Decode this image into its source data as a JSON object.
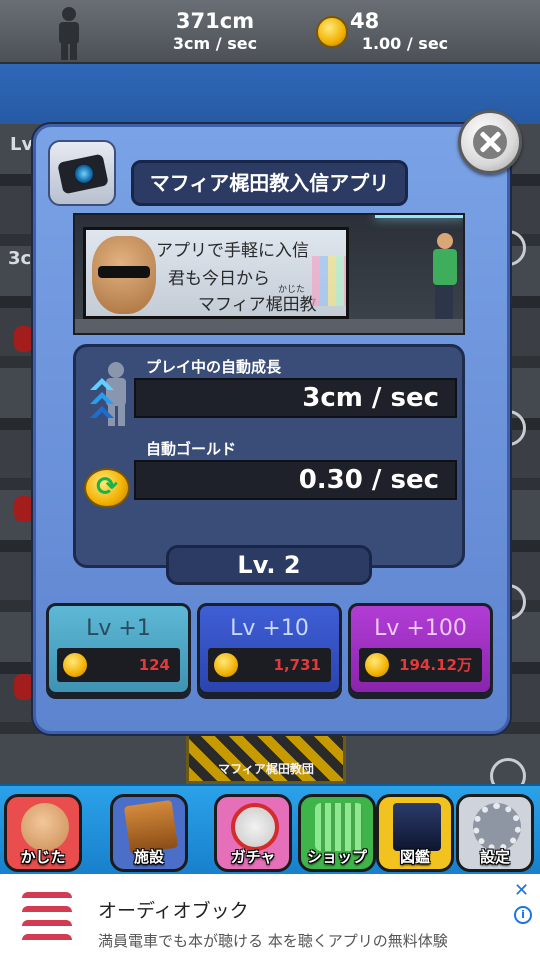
{
  "status_bar": {
    "height_total": "371cm",
    "height_rate": "3cm / sec",
    "gold_total": "48",
    "gold_rate": "1.00 / sec"
  },
  "background": {
    "lv_tag": "Lv",
    "height_tag": "3c",
    "sign_text": "マフィア梶田教団"
  },
  "modal": {
    "title": "マフィア梶田教入信アプリ",
    "banner": {
      "line1": "アプリで手軽に入信",
      "line2": "君も今日から",
      "line3": "マフィア梶田教",
      "ruby": "かじた"
    },
    "stats": [
      {
        "label": "プレイ中の自動成長",
        "value": "3cm / sec",
        "icon": "growth-arrows-icon"
      },
      {
        "label": "自動ゴールド",
        "value": "0.30 / sec",
        "icon": "gold-cycle-icon"
      }
    ],
    "level": "Lv. 2",
    "upgrade_buttons": [
      {
        "label": "Lv +1",
        "cost": "124",
        "color": "#4aa6c6"
      },
      {
        "label": "Lv +10",
        "cost": "1,731",
        "color": "#3453c4"
      },
      {
        "label": "Lv +100",
        "cost": "194.12万",
        "color": "#a030c4"
      }
    ]
  },
  "bottom_nav": [
    {
      "label": "かじた",
      "icon": "kajita-face-icon"
    },
    {
      "label": "施設",
      "icon": "facility-icon"
    },
    {
      "label": "ガチャ",
      "icon": "gacha-icon"
    },
    {
      "label": "ショップ",
      "icon": "shop-basket-icon"
    },
    {
      "label": "図鑑",
      "icon": "encyclopedia-icon"
    },
    {
      "label": "設定",
      "icon": "gear-icon"
    }
  ],
  "ad": {
    "title": "オーディオブック",
    "description": "満員電車でも本が聴ける 本を聴くアプリの無料体験",
    "close_glyph": "✕",
    "info_glyph": "i"
  },
  "colors": {
    "accent_blue": "#2ba2e9",
    "modal_blue": "#6e96de",
    "cost_red": "#e23a3a"
  }
}
